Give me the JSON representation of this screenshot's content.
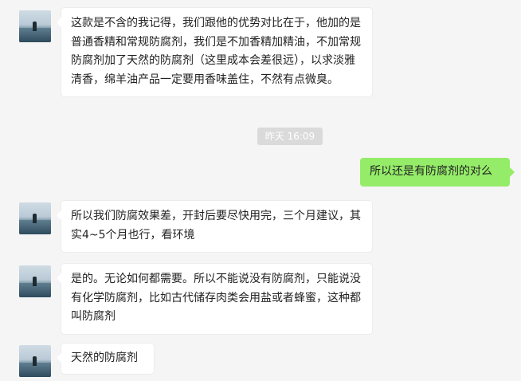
{
  "messages": [
    {
      "side": "left",
      "text": "这款是不含的我记得，我们跟他的优势对比在于，他加的是普通香精和常规防腐剂，我们是不加香精加精油，不加常规防腐剂加了天然的防腐剂（这里成本会差很远），以求淡雅清香，绵羊油产品一定要用香味盖住，不然有点微臭。"
    },
    {
      "side": "right",
      "text": "所以还是有防腐剂的对么"
    },
    {
      "side": "left",
      "text": "所以我们防腐效果差，开封后要尽快用完，三个月建议，其实4~5个月也行，看环境"
    },
    {
      "side": "left",
      "text": "是的。无论如何都需要。所以不能说没有防腐剂，只能说没有化学防腐剂，比如古代储存肉类会用盐或者蜂蜜，这种都叫防腐剂"
    },
    {
      "side": "left",
      "text": "天然的防腐剂"
    }
  ],
  "timestamp": "昨天 16:09",
  "colors": {
    "background": "#f5f5f5",
    "self_bubble": "#95ec69",
    "other_bubble": "#ffffff",
    "timestamp_bg": "#dadada"
  }
}
